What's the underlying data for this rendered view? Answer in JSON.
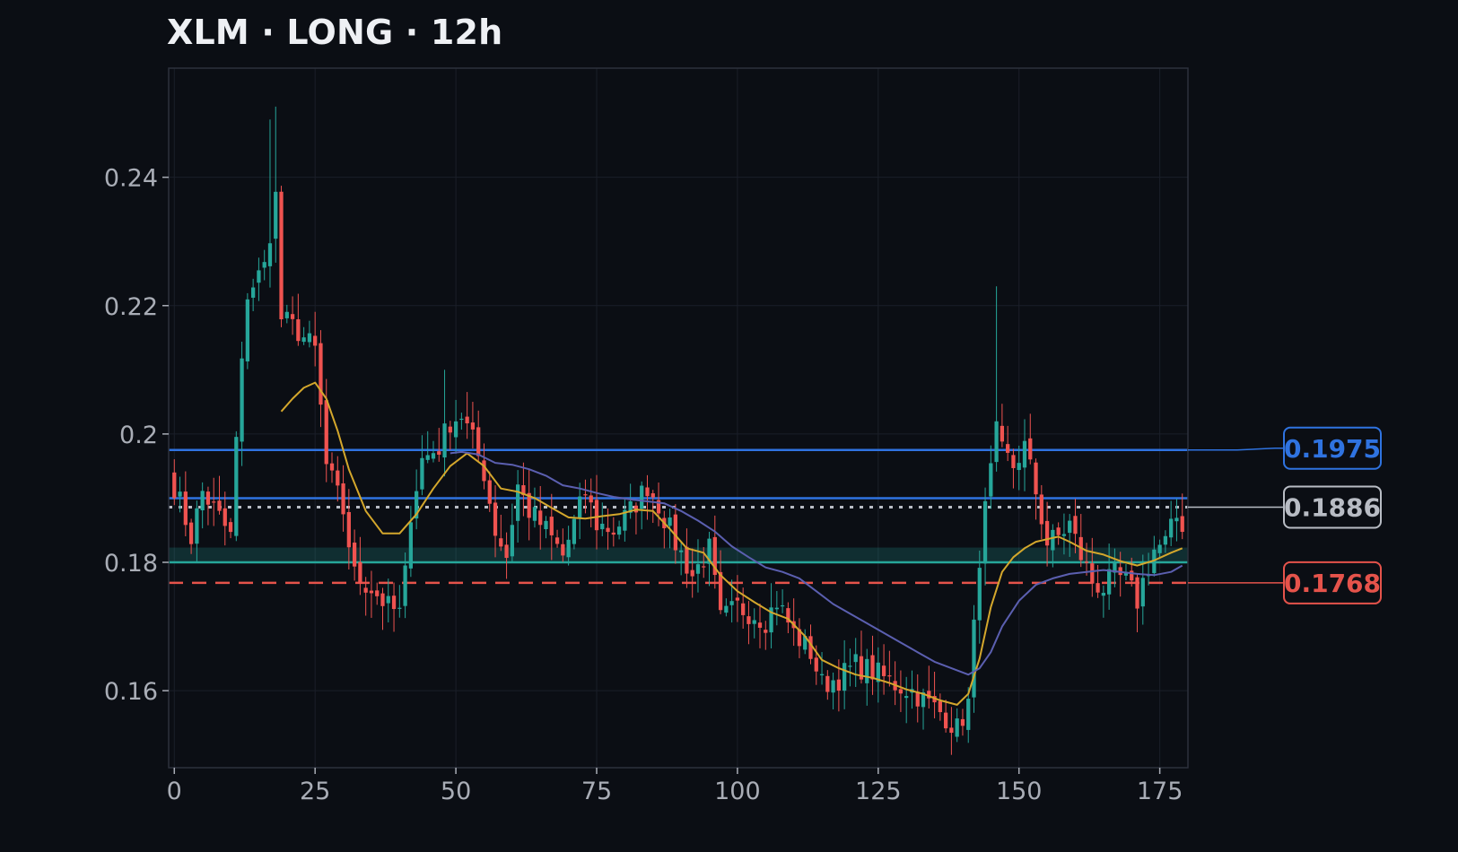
{
  "title": "XLM · LONG · 12h",
  "colors": {
    "background": "#0b0e14",
    "up": "#26a69a",
    "down": "#ef5350",
    "ma_fast": "#d4a72c",
    "ma_slow": "#5b5fb0",
    "resistance": "#2f73e0",
    "entry": "#b8bcc4",
    "stop": "#e5534b",
    "support": "#26a69a",
    "grid": "#1b1f29"
  },
  "chart_data": {
    "type": "candlestick",
    "title": "XLM · LONG · 12h",
    "xlabel": "",
    "ylabel": "",
    "xlim": [
      -1,
      180
    ],
    "ylim": [
      0.148,
      0.257
    ],
    "x_ticks": [
      0,
      25,
      50,
      75,
      100,
      125,
      150,
      175
    ],
    "y_ticks": [
      0.16,
      0.18,
      0.2,
      0.22,
      0.24
    ],
    "y_tick_labels": [
      "0.16",
      "0.18",
      "0.2",
      "0.22",
      "0.24"
    ],
    "grid": true,
    "close_anchors": [
      [
        0,
        0.192
      ],
      [
        3,
        0.184
      ],
      [
        5,
        0.191
      ],
      [
        8,
        0.187
      ],
      [
        10,
        0.184
      ],
      [
        11,
        0.199
      ],
      [
        13,
        0.222
      ],
      [
        16,
        0.226
      ],
      [
        18,
        0.237
      ],
      [
        19,
        0.218
      ],
      [
        22,
        0.216
      ],
      [
        25,
        0.213
      ],
      [
        27,
        0.195
      ],
      [
        30,
        0.188
      ],
      [
        32,
        0.178
      ],
      [
        35,
        0.176
      ],
      [
        38,
        0.173
      ],
      [
        40,
        0.172
      ],
      [
        41,
        0.178
      ],
      [
        42,
        0.188
      ],
      [
        44,
        0.196
      ],
      [
        47,
        0.198
      ],
      [
        49,
        0.202
      ],
      [
        51,
        0.203
      ],
      [
        53,
        0.199
      ],
      [
        55,
        0.194
      ],
      [
        57,
        0.185
      ],
      [
        59,
        0.181
      ],
      [
        61,
        0.192
      ],
      [
        63,
        0.188
      ],
      [
        66,
        0.185
      ],
      [
        69,
        0.181
      ],
      [
        71,
        0.186
      ],
      [
        73,
        0.191
      ],
      [
        75,
        0.186
      ],
      [
        78,
        0.185
      ],
      [
        81,
        0.188
      ],
      [
        84,
        0.192
      ],
      [
        86,
        0.189
      ],
      [
        89,
        0.183
      ],
      [
        92,
        0.178
      ],
      [
        95,
        0.182
      ],
      [
        97,
        0.171
      ],
      [
        100,
        0.173
      ],
      [
        103,
        0.172
      ],
      [
        105,
        0.171
      ],
      [
        107,
        0.174
      ],
      [
        110,
        0.169
      ],
      [
        113,
        0.166
      ],
      [
        115,
        0.161
      ],
      [
        118,
        0.162
      ],
      [
        121,
        0.164
      ],
      [
        124,
        0.163
      ],
      [
        128,
        0.161
      ],
      [
        131,
        0.16
      ],
      [
        134,
        0.158
      ],
      [
        137,
        0.156
      ],
      [
        139,
        0.154
      ],
      [
        141,
        0.158
      ],
      [
        143,
        0.181
      ],
      [
        144,
        0.188
      ],
      [
        146,
        0.2
      ],
      [
        147,
        0.197
      ],
      [
        149,
        0.195
      ],
      [
        151,
        0.198
      ],
      [
        153,
        0.191
      ],
      [
        155,
        0.183
      ],
      [
        157,
        0.184
      ],
      [
        159,
        0.186
      ],
      [
        161,
        0.181
      ],
      [
        163,
        0.177
      ],
      [
        165,
        0.176
      ],
      [
        167,
        0.178
      ],
      [
        169,
        0.177
      ],
      [
        171,
        0.174
      ],
      [
        172,
        0.177
      ],
      [
        174,
        0.182
      ],
      [
        176,
        0.183
      ],
      [
        178,
        0.187
      ],
      [
        179,
        0.186
      ]
    ],
    "spike_highs": {
      "17": 0.249,
      "18": 0.251,
      "48": 0.21,
      "146": 0.223
    },
    "spike_lows": {
      "139": 0.152,
      "140": 0.153
    },
    "moving_averages": [
      {
        "period": "fast",
        "color": "#d4a72c",
        "points": [
          [
            19,
            0.2035
          ],
          [
            21,
            0.2055
          ],
          [
            23,
            0.2072
          ],
          [
            25,
            0.208
          ],
          [
            27,
            0.2055
          ],
          [
            29,
            0.2005
          ],
          [
            31,
            0.1945
          ],
          [
            34,
            0.188
          ],
          [
            37,
            0.1845
          ],
          [
            40,
            0.1845
          ],
          [
            43,
            0.1875
          ],
          [
            46,
            0.1915
          ],
          [
            49,
            0.195
          ],
          [
            52,
            0.197
          ],
          [
            55,
            0.195
          ],
          [
            58,
            0.1915
          ],
          [
            61,
            0.191
          ],
          [
            64,
            0.19
          ],
          [
            67,
            0.1885
          ],
          [
            70,
            0.187
          ],
          [
            73,
            0.1868
          ],
          [
            76,
            0.1872
          ],
          [
            79,
            0.1875
          ],
          [
            82,
            0.1882
          ],
          [
            85,
            0.188
          ],
          [
            88,
            0.1852
          ],
          [
            91,
            0.1822
          ],
          [
            94,
            0.1815
          ],
          [
            97,
            0.178
          ],
          [
            100,
            0.1755
          ],
          [
            103,
            0.1738
          ],
          [
            106,
            0.1722
          ],
          [
            109,
            0.1712
          ],
          [
            112,
            0.1685
          ],
          [
            115,
            0.1648
          ],
          [
            118,
            0.1635
          ],
          [
            121,
            0.1625
          ],
          [
            124,
            0.162
          ],
          [
            127,
            0.1612
          ],
          [
            130,
            0.1602
          ],
          [
            133,
            0.1595
          ],
          [
            136,
            0.1585
          ],
          [
            139,
            0.1578
          ],
          [
            141,
            0.1595
          ],
          [
            143,
            0.165
          ],
          [
            145,
            0.173
          ],
          [
            147,
            0.1785
          ],
          [
            149,
            0.1808
          ],
          [
            151,
            0.1822
          ],
          [
            153,
            0.1832
          ],
          [
            155,
            0.1836
          ],
          [
            157,
            0.184
          ],
          [
            159,
            0.1832
          ],
          [
            162,
            0.1818
          ],
          [
            165,
            0.1812
          ],
          [
            168,
            0.1802
          ],
          [
            171,
            0.1795
          ],
          [
            174,
            0.1803
          ],
          [
            177,
            0.1815
          ],
          [
            179,
            0.1822
          ]
        ]
      },
      {
        "period": "slow",
        "color": "#5b5fb0",
        "points": [
          [
            49,
            0.197
          ],
          [
            51,
            0.1972
          ],
          [
            54,
            0.1968
          ],
          [
            57,
            0.1955
          ],
          [
            60,
            0.1952
          ],
          [
            63,
            0.1945
          ],
          [
            66,
            0.1935
          ],
          [
            69,
            0.192
          ],
          [
            72,
            0.1915
          ],
          [
            75,
            0.1908
          ],
          [
            78,
            0.1902
          ],
          [
            81,
            0.1898
          ],
          [
            84,
            0.1895
          ],
          [
            87,
            0.1892
          ],
          [
            90,
            0.188
          ],
          [
            93,
            0.1865
          ],
          [
            96,
            0.1848
          ],
          [
            99,
            0.1825
          ],
          [
            102,
            0.1808
          ],
          [
            105,
            0.1792
          ],
          [
            108,
            0.1785
          ],
          [
            111,
            0.1775
          ],
          [
            114,
            0.1755
          ],
          [
            117,
            0.1735
          ],
          [
            120,
            0.172
          ],
          [
            123,
            0.1705
          ],
          [
            126,
            0.169
          ],
          [
            129,
            0.1675
          ],
          [
            132,
            0.166
          ],
          [
            135,
            0.1645
          ],
          [
            138,
            0.1635
          ],
          [
            141,
            0.1625
          ],
          [
            143,
            0.1635
          ],
          [
            145,
            0.166
          ],
          [
            147,
            0.17
          ],
          [
            150,
            0.174
          ],
          [
            153,
            0.1765
          ],
          [
            156,
            0.1775
          ],
          [
            159,
            0.1782
          ],
          [
            162,
            0.1785
          ],
          [
            165,
            0.1788
          ],
          [
            168,
            0.1785
          ],
          [
            171,
            0.1782
          ],
          [
            174,
            0.178
          ],
          [
            177,
            0.1785
          ],
          [
            179,
            0.1795
          ]
        ]
      }
    ],
    "levels": [
      {
        "price": 0.1975,
        "label": "0.1975",
        "style": "solid",
        "color": "#2f73e0",
        "badge": true
      },
      {
        "price": 0.19,
        "label": "",
        "style": "solid",
        "color": "#2f73e0",
        "badge": false
      },
      {
        "price": 0.1886,
        "label": "0.1886",
        "style": "dotted",
        "color": "#b8bcc4",
        "badge": true
      },
      {
        "price": 0.18,
        "label": "",
        "style": "solid",
        "color": "#26a69a",
        "badge": false
      },
      {
        "price": 0.1768,
        "label": "0.1768",
        "style": "dashed",
        "color": "#e5534b",
        "badge": true
      }
    ],
    "zones": [
      {
        "from": 0.18,
        "to": 0.1823,
        "color": "#26a69a"
      }
    ]
  }
}
